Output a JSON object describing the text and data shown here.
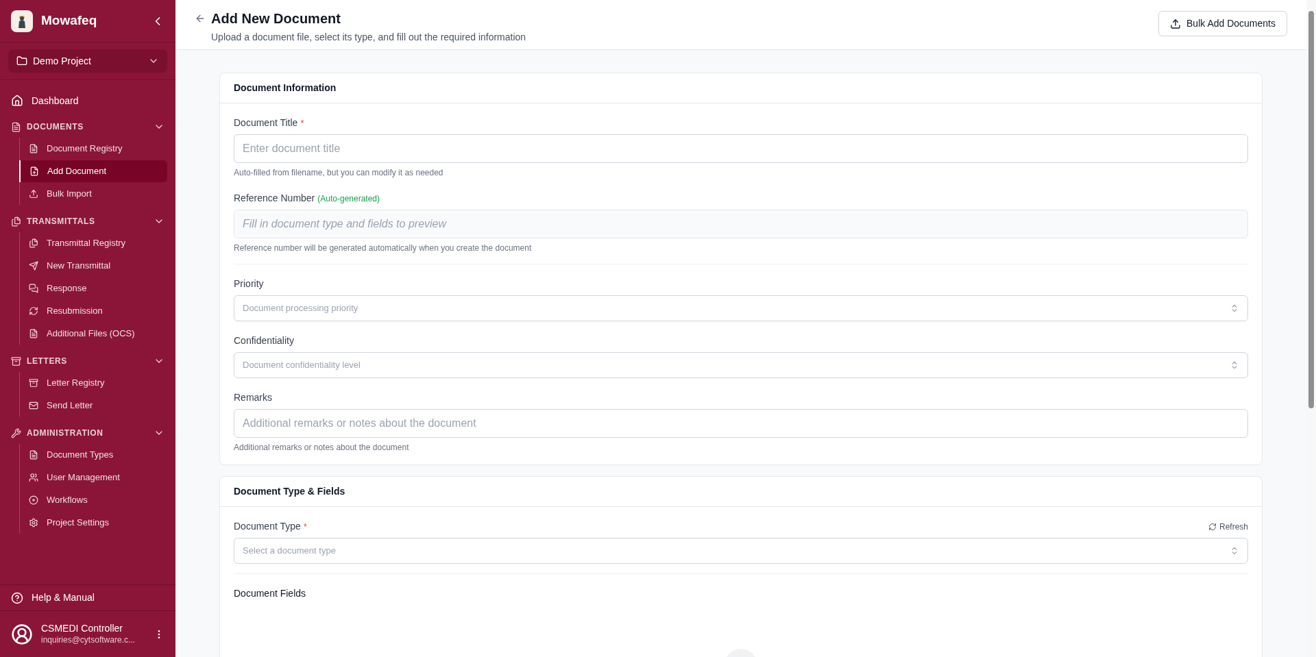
{
  "sidebar": {
    "app_name": "Mowafeq",
    "project": "Demo Project",
    "dashboard": {
      "label": "Dashboard",
      "selected": false
    },
    "sections": [
      {
        "title": "DOCUMENTS",
        "expanded": true,
        "items": [
          {
            "label": "Document Registry",
            "selected": false
          },
          {
            "label": "Add Document",
            "selected": true
          },
          {
            "label": "Bulk Import",
            "selected": false
          }
        ]
      },
      {
        "title": "TRANSMITTALS",
        "expanded": true,
        "items": [
          {
            "label": "Transmittal Registry",
            "selected": false
          },
          {
            "label": "New Transmittal",
            "selected": false
          },
          {
            "label": "Response",
            "selected": false
          },
          {
            "label": "Resubmission",
            "selected": false
          },
          {
            "label": "Additional Files (OCS)",
            "selected": false
          }
        ]
      },
      {
        "title": "LETTERS",
        "expanded": true,
        "items": [
          {
            "label": "Letter Registry",
            "selected": false
          },
          {
            "label": "Send Letter",
            "selected": false
          }
        ]
      },
      {
        "title": "ADMINISTRATION",
        "expanded": true,
        "items": [
          {
            "label": "Document Types",
            "selected": false
          },
          {
            "label": "User Management",
            "selected": false
          },
          {
            "label": "Workflows",
            "selected": false
          },
          {
            "label": "Project Settings",
            "selected": false
          }
        ]
      }
    ],
    "help": "Help & Manual",
    "user": {
      "name": "CSMEDI Controller",
      "email": "inquiries@cytsoftware.c..."
    }
  },
  "header": {
    "title": "Add New Document",
    "subtitle": "Upload a document file, select its type, and fill out the required information",
    "button": "Bulk Add Documents"
  },
  "cards": [
    {
      "title": "Document Information",
      "fields": [
        {
          "kind": "text",
          "label": "Document Title",
          "required_mark": "*",
          "placeholder": "Enter document title",
          "hint": "Auto-filled from filename, but you can modify it as needed"
        },
        {
          "kind": "readonly",
          "label": "Reference Number",
          "note": "(Auto-generated)",
          "placeholder": "Fill in document type and fields to preview",
          "hint": "Reference number will be generated automatically when you create the document"
        },
        {
          "kind": "divider"
        },
        {
          "kind": "select",
          "label": "Priority",
          "placeholder": "Document processing priority"
        },
        {
          "kind": "select",
          "label": "Confidentiality",
          "placeholder": "Document confidentiality level"
        },
        {
          "kind": "text",
          "label": "Remarks",
          "placeholder": "Additional remarks or notes about the document",
          "hint": "Additional remarks or notes about the document"
        }
      ]
    },
    {
      "title": "Document Type & Fields",
      "fields": [
        {
          "kind": "select",
          "label": "Document Type",
          "required_mark": "*",
          "action": "Refresh",
          "placeholder": "Select a document type"
        },
        {
          "kind": "divider"
        },
        {
          "kind": "heading",
          "label": "Document Fields"
        },
        {
          "kind": "empty"
        }
      ]
    }
  ]
}
